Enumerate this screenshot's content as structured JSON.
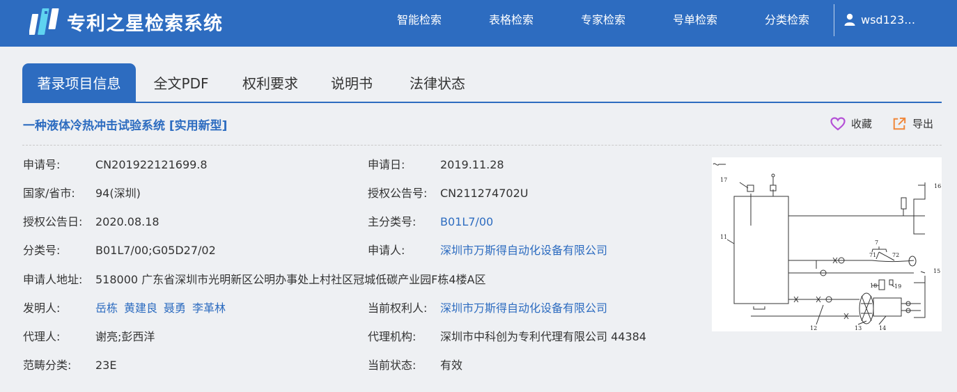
{
  "header": {
    "brand": "专利之星检索系统",
    "nav": [
      {
        "label": "智能检索"
      },
      {
        "label": "表格检索"
      },
      {
        "label": "专家检索"
      },
      {
        "label": "号单检索"
      },
      {
        "label": "分类检索"
      }
    ],
    "user": "wsd123…"
  },
  "tabs": [
    {
      "label": "著录项目信息",
      "active": true
    },
    {
      "label": "全文PDF"
    },
    {
      "label": "权利要求"
    },
    {
      "label": "说明书"
    },
    {
      "label": "法律状态"
    }
  ],
  "patent": {
    "title": "一种液体冷热冲击试验系统 [实用新型]",
    "actions": {
      "favorite": "收藏",
      "export": "导出"
    },
    "fields": {
      "app_no": {
        "label": "申请号:",
        "value": "CN201922121699.8"
      },
      "app_date": {
        "label": "申请日:",
        "value": "2019.11.28"
      },
      "region": {
        "label": "国家/省市:",
        "value": "94(深圳)"
      },
      "pub_no": {
        "label": "授权公告号:",
        "value": "CN211274702U"
      },
      "pub_date": {
        "label": "授权公告日:",
        "value": "2020.08.18"
      },
      "main_class": {
        "label": "主分类号:",
        "value": "B01L7/00"
      },
      "classes": {
        "label": "分类号:",
        "value": "B01L7/00;G05D27/02"
      },
      "applicant": {
        "label": "申请人:",
        "value": "深圳市万斯得自动化设备有限公司"
      },
      "address": {
        "label": "申请人地址:",
        "value": "518000 广东省深圳市光明新区公明办事处上村社区冠城低碳产业园F栋4楼A区"
      },
      "inventors": {
        "label": "发明人:",
        "values": [
          "岳栋",
          "黄建良",
          "聂勇",
          "李革林"
        ]
      },
      "holder": {
        "label": "当前权利人:",
        "value": "深圳市万斯得自动化设备有限公司"
      },
      "agent": {
        "label": "代理人:",
        "value": "谢亮;彭西洋"
      },
      "agency": {
        "label": "代理机构:",
        "value": "深圳市中科创为专利代理有限公司 44384"
      },
      "category": {
        "label": "范畴分类:",
        "value": "23E"
      },
      "status": {
        "label": "当前状态:",
        "value": "有效"
      }
    },
    "figure_labels": [
      "17",
      "16",
      "11",
      "7",
      "71",
      "72",
      "15",
      "18",
      "19",
      "12",
      "13",
      "14"
    ]
  },
  "colors": {
    "primary": "#2d6cc0",
    "background": "#eef0f3",
    "favorite": "#b44fd6",
    "export": "#f0873a"
  }
}
